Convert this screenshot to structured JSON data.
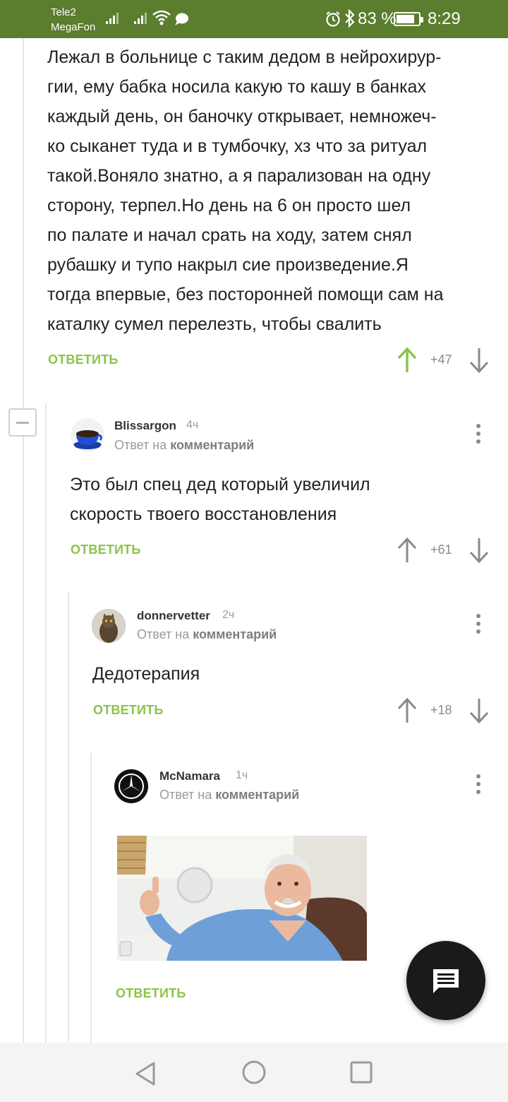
{
  "status_bar": {
    "carrier1": "Tele2",
    "carrier2": "MegaFon",
    "battery_text": "83 %",
    "battery_level": 0.83,
    "time": "8:29",
    "icons": [
      "signal-icon",
      "wifi-icon",
      "chat-bubble-icon",
      "alarm-icon",
      "bluetooth-icon",
      "battery-icon"
    ]
  },
  "comments": [
    {
      "text": "Лежал в больнице с таким дедом в нейрохирур-\nгии, ему бабка носила какую то кашу в банках\nкаждый день, он баночку открывает, немножеч-\nко сыканет туда и в тумбочку, хз что за ритуал\nтакой.Воняло знатно, а я парализован на одну\nсторону, терпел.Но день на 6 он просто шел\nпо палате и начал срать на ходу, затем снял\nрубашку и тупо накрыл сие произведение.Я\nтогда впервые, без посторонней помощи сам на\nкаталку сумел перелезть, чтобы свалить",
      "reply_label": "ОТВЕТИТЬ",
      "rating": "+47"
    },
    {
      "author": "Blissargon",
      "time": "4ч",
      "reply_to_prefix": "Ответ на",
      "reply_to_link": "комментарий",
      "text": "Это был спец дед который увеличил\nскорость твоего восстановления",
      "reply_label": "ОТВЕТИТЬ",
      "rating": "+61"
    },
    {
      "author": "donnervetter",
      "time": "2ч",
      "reply_to_prefix": "Ответ на",
      "reply_to_link": "комментарий",
      "text": "Дедотерапия",
      "reply_label": "ОТВЕТИТЬ",
      "rating": "+18"
    },
    {
      "author": "McNamara",
      "time": "1ч",
      "reply_to_prefix": "Ответ на",
      "reply_to_link": "комментарий",
      "reply_label": "ОТВЕТИТЬ"
    }
  ],
  "colors": {
    "status_bar": "#5a7d2e",
    "reply_green": "#8bc34a",
    "upvoted_green": "#8bc34a",
    "vote_gray": "#8a8a8a",
    "fab": "#1a1a1a"
  }
}
